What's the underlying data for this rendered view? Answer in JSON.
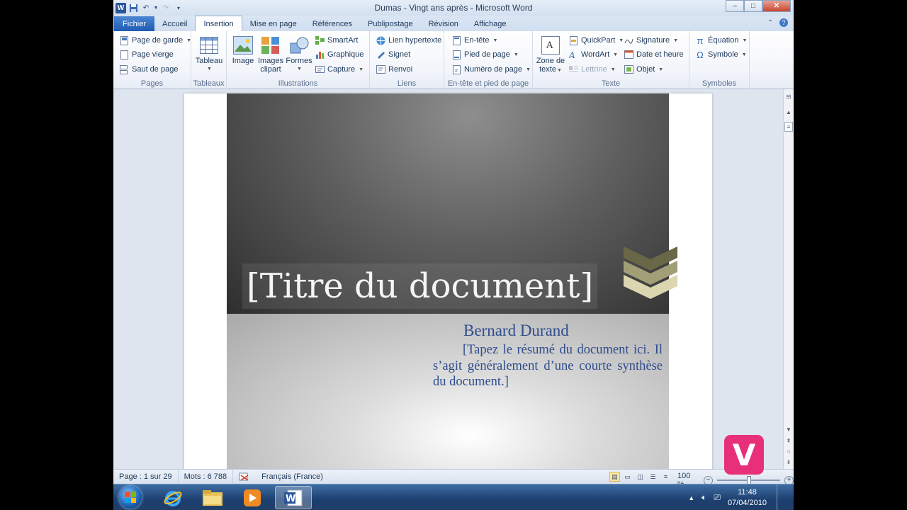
{
  "window": {
    "title": "Dumas - Vingt ans après - Microsoft Word",
    "controls": {
      "minimize": "–",
      "maximize": "□",
      "close": "✕"
    }
  },
  "tabs": [
    {
      "label": "Fichier"
    },
    {
      "label": "Accueil"
    },
    {
      "label": "Insertion"
    },
    {
      "label": "Mise en page"
    },
    {
      "label": "Références"
    },
    {
      "label": "Publipostage"
    },
    {
      "label": "Révision"
    },
    {
      "label": "Affichage"
    }
  ],
  "active_tab": "Insertion",
  "ribbon": {
    "pages": {
      "label": "Pages",
      "cover": "Page de garde",
      "blank": "Page vierge",
      "break": "Saut de page"
    },
    "tableaux": {
      "label": "Tableaux",
      "table": "Tableau"
    },
    "illustrations": {
      "label": "Illustrations",
      "image": "Image",
      "clipart1": "Images",
      "clipart2": "clipart",
      "formes": "Formes",
      "smartart": "SmartArt",
      "graphique": "Graphique",
      "capture": "Capture"
    },
    "liens": {
      "label": "Liens",
      "hyperlink": "Lien hypertexte",
      "signet": "Signet",
      "renvoi": "Renvoi"
    },
    "entete": {
      "label": "En-tête et pied de page",
      "header": "En-tête",
      "footer": "Pied de page",
      "pagenum": "Numéro de page"
    },
    "texte": {
      "label": "Texte",
      "zone1": "Zone de",
      "zone2": "texte",
      "quickpart": "QuickPart",
      "wordart": "WordArt",
      "lettrine": "Lettrine",
      "signature": "Signature",
      "date": "Date et heure",
      "objet": "Objet"
    },
    "symboles": {
      "label": "Symboles",
      "equation": "Équation",
      "symbole": "Symbole"
    }
  },
  "document": {
    "title": "[Titre du document]",
    "author": "Bernard Durand",
    "abstract": "[Tapez le résumé du document ici. Il s’agit généralement d’une courte synthèse du document.]"
  },
  "statusbar": {
    "page": "Page : 1 sur 29",
    "words": "Mots : 6 788",
    "language": "Français (France)",
    "zoom": "100 %",
    "zoom_level": 1.0
  },
  "taskbar": {
    "time": "11:48",
    "date": "07/04/2010"
  },
  "watermark": {
    "letter": "V"
  },
  "colors": {
    "accent": "#2a5599",
    "title_text": "#f5f5f5",
    "author_text": "#2e4d8c",
    "watermark": "#e8307a"
  }
}
